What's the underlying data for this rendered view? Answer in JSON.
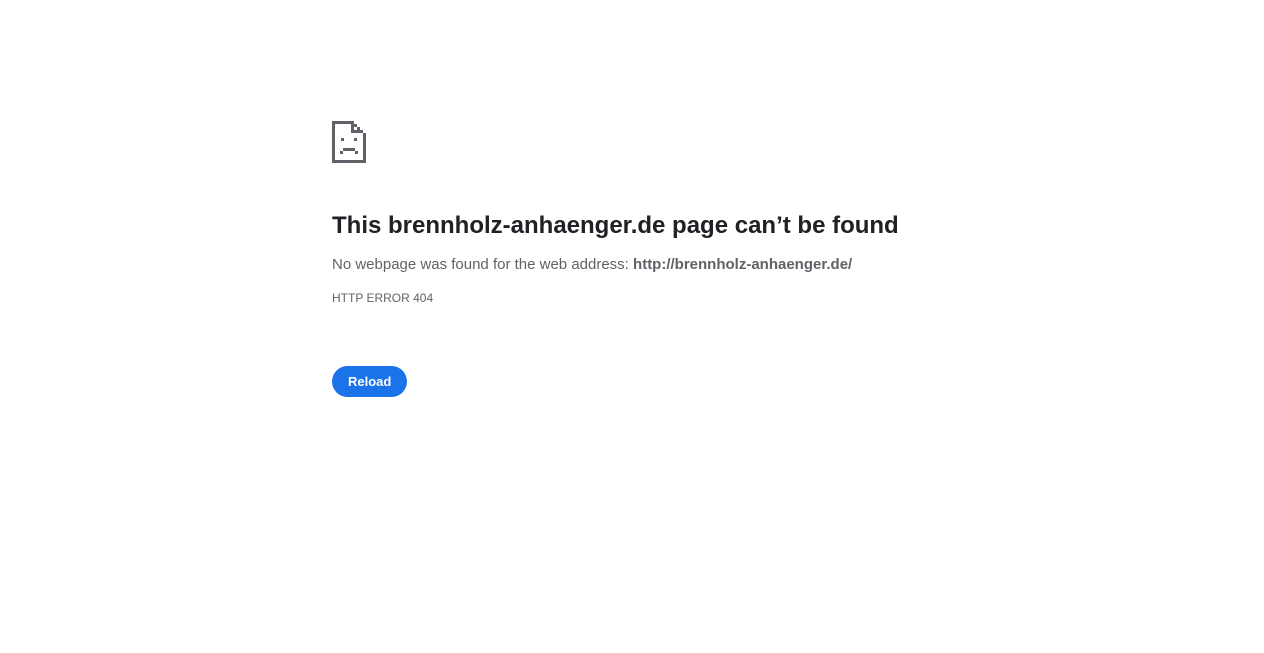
{
  "error": {
    "icon": "sad-document-icon",
    "title": "This brennholz-anhaenger.de page can’t be found",
    "details_prefix": "No webpage was found for the web address: ",
    "url": "http://brennholz-anhaenger.de/",
    "code": "HTTP ERROR 404"
  },
  "actions": {
    "reload_label": "Reload"
  },
  "colors": {
    "accent": "#1a73e8",
    "title_text": "#202124",
    "secondary_text": "#5f6368",
    "icon": "#5f6368"
  }
}
